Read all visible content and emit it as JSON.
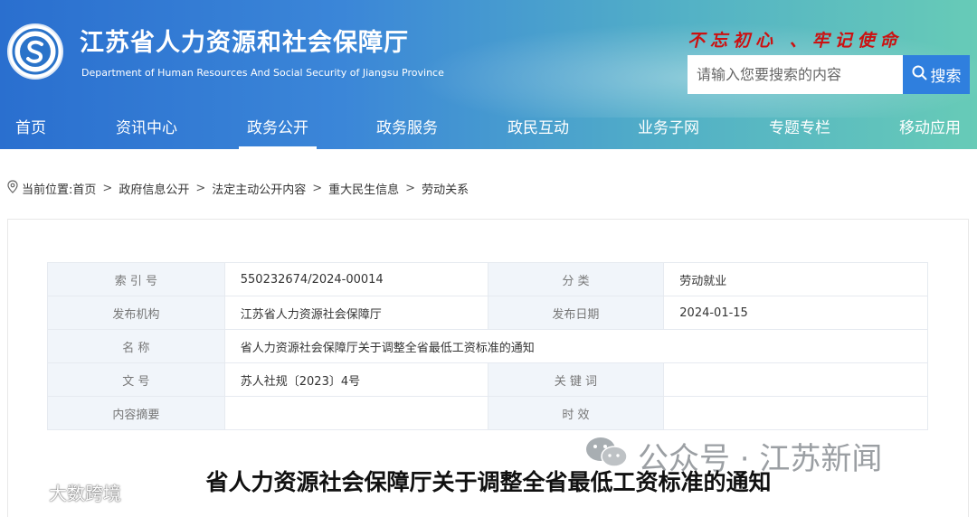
{
  "header": {
    "title": "江苏省人力资源和社会保障厅",
    "subtitle": "Department of Human Resources And Social Security of Jiangsu Province",
    "slogan": "不忘初心  、牢记使命",
    "search": {
      "placeholder": "请输入您要搜索的内容",
      "button_label": "搜索",
      "icon": "search-icon"
    },
    "logo_icon": "ministry-logo-icon"
  },
  "nav": {
    "items": [
      {
        "label": "首页"
      },
      {
        "label": "资讯中心"
      },
      {
        "label": "政务公开",
        "active": true
      },
      {
        "label": "政务服务"
      },
      {
        "label": "政民互动"
      },
      {
        "label": "业务子网"
      },
      {
        "label": "专题专栏"
      },
      {
        "label": "移动应用"
      }
    ]
  },
  "breadcrumb": {
    "prefix": "当前位置:",
    "items": [
      "首页",
      "政府信息公开",
      "法定主动公开内容",
      "重大民生信息",
      "劳动关系"
    ],
    "separator": ">"
  },
  "meta": {
    "index_label": "索 引 号",
    "index_value": "550232674/2024-00014",
    "category_label": "分 类",
    "category_value": "劳动就业",
    "publisher_label": "发布机构",
    "publisher_value": "江苏省人力资源社会保障厅",
    "date_label": "发布日期",
    "date_value": "2024-01-15",
    "name_label": "名 称",
    "name_value": "省人力资源社会保障厅关于调整全省最低工资标准的通知",
    "docno_label": "文 号",
    "docno_value": "苏人社规〔2023〕4号",
    "keywords_label": "关 键 词",
    "keywords_value": "",
    "summary_label": "内容摘要",
    "summary_value": "",
    "validity_label": "时 效",
    "validity_value": ""
  },
  "document": {
    "title": "省人力资源社会保障厅关于调整全省最低工资标准的通知"
  },
  "watermarks": {
    "right": "公众号 · 江苏新闻",
    "left": "大数跨境"
  },
  "colors": {
    "header_start": "#2a6fcf",
    "header_end": "#67cbb7",
    "slogan": "#cc1111",
    "search_button": "#2f7fde",
    "label_bg": "#f1f5fa"
  }
}
